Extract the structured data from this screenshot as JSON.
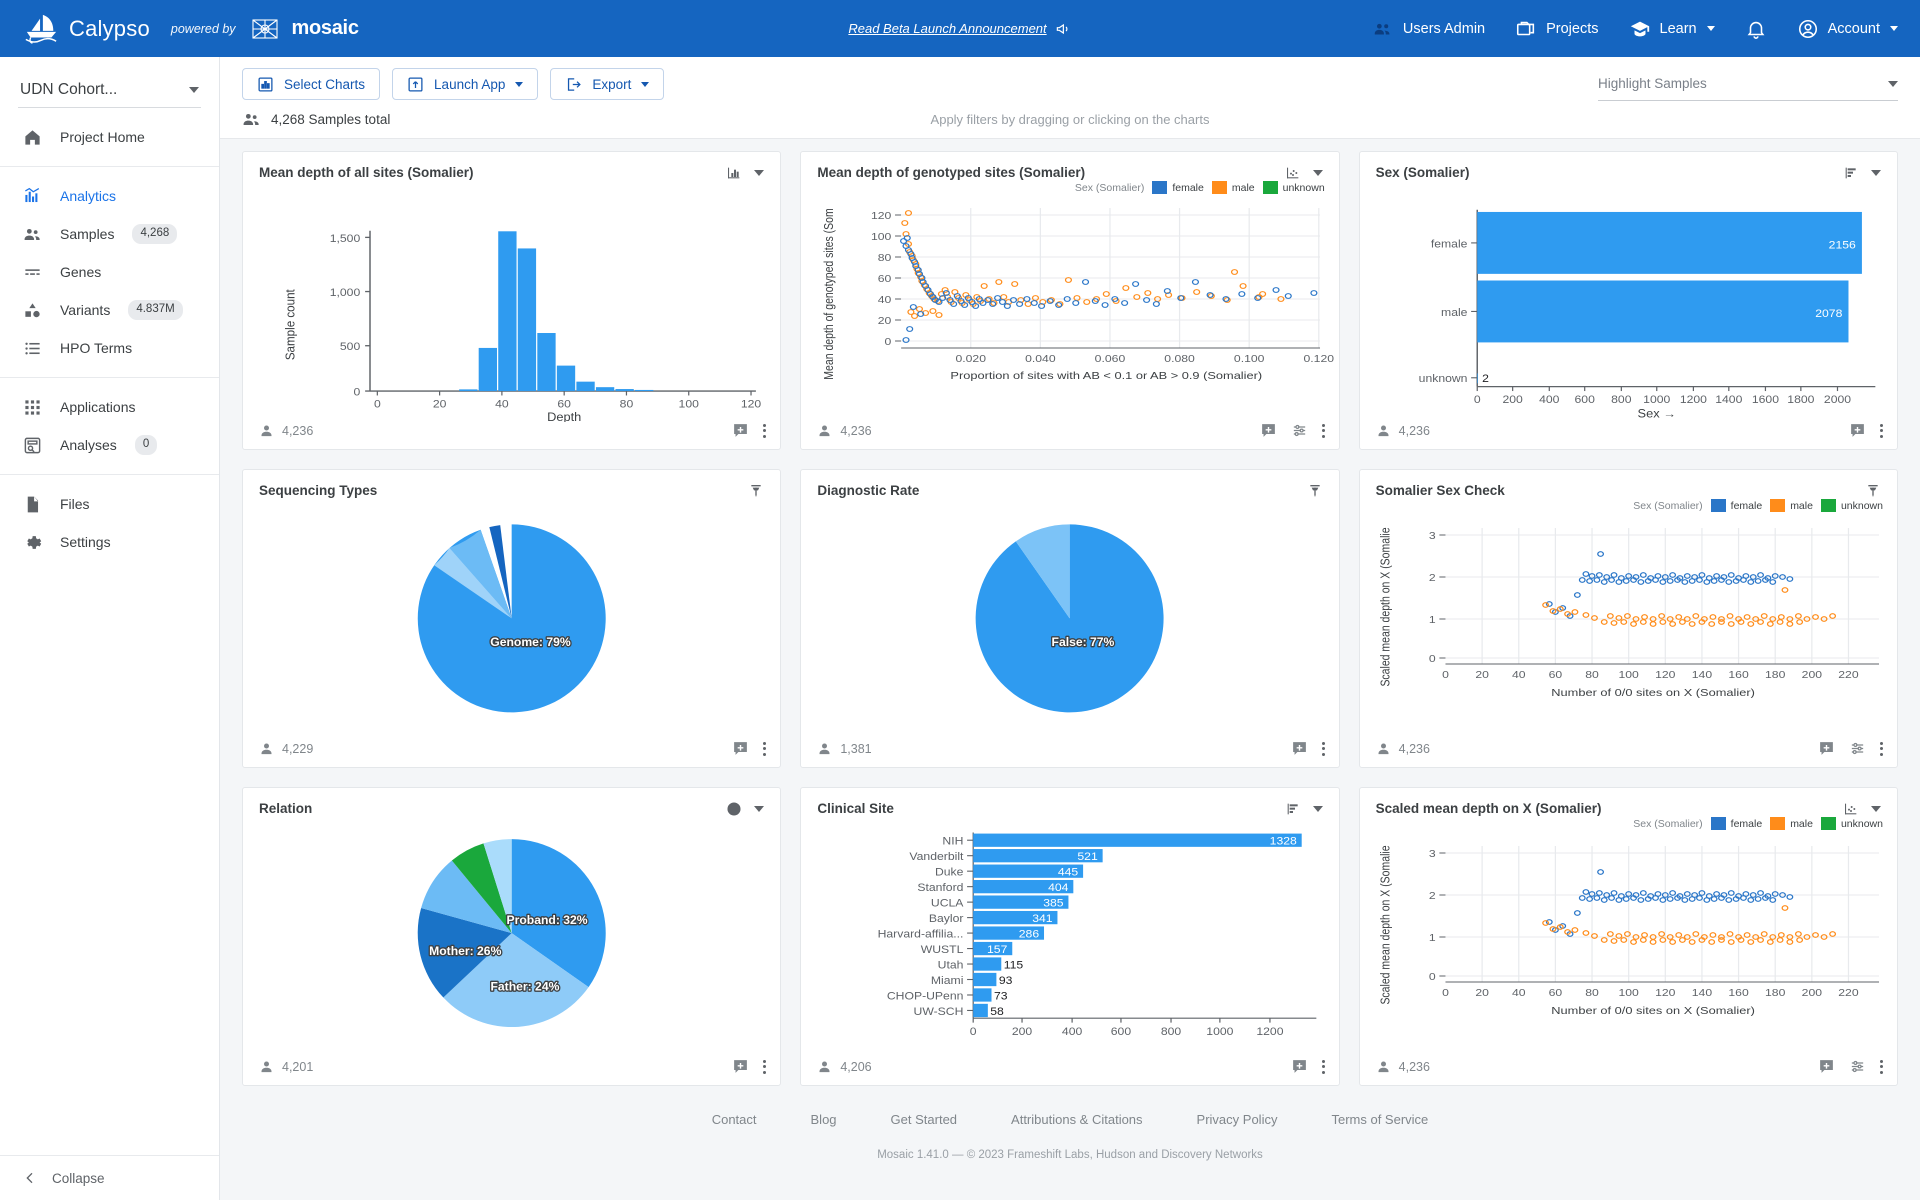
{
  "topbar": {
    "brand_name": "Calypso",
    "powered_by": "powered by",
    "mosaic": "mosaic",
    "announcement": "Read Beta Launch Announcement",
    "nav": [
      {
        "label": "Users Admin",
        "icon": "users-icon"
      },
      {
        "label": "Projects",
        "icon": "folder-icon"
      },
      {
        "label": "Learn",
        "icon": "school-icon",
        "caret": true
      },
      {
        "label": "",
        "icon": "bell-icon"
      },
      {
        "label": "Account",
        "icon": "account-icon",
        "caret": true
      }
    ],
    "accent": "#1565c0"
  },
  "sidebar": {
    "cohort": "UDN Cohort...",
    "groups": [
      {
        "items": [
          {
            "label": "Project Home",
            "icon": "home-icon",
            "badge": null,
            "active": false
          }
        ]
      },
      {
        "items": [
          {
            "label": "Analytics",
            "icon": "analytics-icon",
            "badge": null,
            "active": true
          },
          {
            "label": "Samples",
            "icon": "people-icon",
            "badge": "4,268",
            "active": false
          },
          {
            "label": "Genes",
            "icon": "genes-icon",
            "badge": null,
            "active": false
          },
          {
            "label": "Variants",
            "icon": "variants-icon",
            "badge": "4.837M",
            "active": false
          },
          {
            "label": "HPO Terms",
            "icon": "list-icon",
            "badge": null,
            "active": false
          }
        ]
      },
      {
        "items": [
          {
            "label": "Applications",
            "icon": "apps-icon",
            "badge": null,
            "active": false
          },
          {
            "label": "Analyses",
            "icon": "analyses-icon",
            "badge": "0",
            "active": false
          }
        ]
      },
      {
        "items": [
          {
            "label": "Files",
            "icon": "files-icon",
            "badge": null,
            "active": false
          },
          {
            "label": "Settings",
            "icon": "gear-icon",
            "badge": null,
            "active": false
          }
        ]
      }
    ],
    "collapse": "Collapse"
  },
  "toolbar": {
    "select_charts": "Select Charts",
    "launch_app": "Launch App",
    "export": "Export",
    "highlight_samples": "Highlight Samples",
    "samples_total": "4,268 Samples total",
    "filter_hint": "Apply filters by dragging or clicking on the charts"
  },
  "legend": {
    "title": "Sex (Somalier)",
    "entries": [
      {
        "label": "female",
        "color": "#2a76c8"
      },
      {
        "label": "male",
        "color": "#ff8c1a"
      },
      {
        "label": "unknown",
        "color": "#1aa83c"
      }
    ]
  },
  "cards": [
    {
      "title": "Mean depth of all sites (Somalier)",
      "count": "4,236",
      "tools": [
        "histogram-icon",
        "chevron-down-icon"
      ],
      "foot_tools": [
        "comment-add-icon",
        "more-icon"
      ]
    },
    {
      "title": "Mean depth of genotyped sites (Somalier)",
      "count": "4,236",
      "tools": [
        "scatter-icon",
        "chevron-down-icon"
      ],
      "foot_tools": [
        "comment-add-icon",
        "settings-sliders-icon",
        "more-icon"
      ]
    },
    {
      "title": "Sex (Somalier)",
      "count": "4,236",
      "tools": [
        "bar-icon",
        "chevron-down-icon"
      ],
      "foot_tools": [
        "comment-add-icon",
        "more-icon"
      ]
    },
    {
      "title": "Sequencing Types",
      "count": "4,229",
      "tools": [
        "pin-icon"
      ],
      "foot_tools": [
        "comment-add-icon",
        "more-icon"
      ]
    },
    {
      "title": "Diagnostic Rate",
      "count": "1,381",
      "tools": [
        "pin-icon"
      ],
      "foot_tools": [
        "comment-add-icon",
        "more-icon"
      ]
    },
    {
      "title": "Somalier Sex Check",
      "count": "4,236",
      "tools": [
        "pin-icon"
      ],
      "foot_tools": [
        "comment-add-icon",
        "settings-sliders-icon",
        "more-icon"
      ]
    },
    {
      "title": "Relation",
      "count": "4,201",
      "tools": [
        "pie-icon",
        "chevron-down-icon"
      ],
      "foot_tools": [
        "comment-add-icon",
        "more-icon"
      ]
    },
    {
      "title": "Clinical Site",
      "count": "4,206",
      "tools": [
        "bar-icon",
        "chevron-down-icon"
      ],
      "foot_tools": [
        "comment-add-icon",
        "more-icon"
      ]
    },
    {
      "title": "Scaled mean depth on X (Somalier)",
      "count": "4,236",
      "tools": [
        "scatter-icon",
        "chevron-down-icon"
      ],
      "foot_tools": [
        "comment-add-icon",
        "settings-sliders-icon",
        "more-icon"
      ]
    }
  ],
  "footer": {
    "links": [
      "Contact",
      "Blog",
      "Get Started",
      "Attributions & Citations",
      "Privacy Policy",
      "Terms of Service"
    ],
    "copyright": "Mosaic 1.41.0 — © 2023 Frameshift Labs, Hudson and Discovery Networks"
  },
  "chart_data": [
    {
      "id": "mean-depth-all-sites",
      "type": "bar",
      "title": "Mean depth of all sites (Somalier)",
      "xlabel": "Depth",
      "ylabel": "Sample count",
      "xlim": [
        0,
        128
      ],
      "ylim": [
        0,
        1600
      ],
      "xticks": [
        0,
        20,
        40,
        60,
        80,
        100,
        120
      ],
      "yticks": [
        0,
        500,
        1000,
        1500
      ],
      "bin_width": 5,
      "bins_x": [
        30,
        35,
        40,
        45,
        50,
        55,
        60,
        65,
        70,
        75
      ],
      "values": [
        18,
        400,
        1490,
        1325,
        540,
        235,
        85,
        30,
        14,
        8
      ],
      "color": "#2f9bf0",
      "grid": false
    },
    {
      "id": "mean-depth-genotyped",
      "type": "scatter",
      "title": "Mean depth of genotyped sites (Somalier)",
      "xlabel": "Proportion of sites with AB < 0.1 or AB > 0.9 (Somalier)",
      "ylabel": "Mean depth of genotyped sites (Som...",
      "xlim": [
        0,
        0.132
      ],
      "ylim": [
        0,
        128
      ],
      "xticks": [
        0.02,
        0.04,
        0.06,
        0.08,
        0.1,
        0.12
      ],
      "yticks": [
        0,
        20,
        40,
        60,
        80,
        100,
        120
      ],
      "legend_title": "Sex (Somalier)",
      "series": [
        {
          "name": "female",
          "color": "#2a76c8"
        },
        {
          "name": "male",
          "color": "#ff8c1a"
        },
        {
          "name": "unknown",
          "color": "#1aa83c"
        }
      ],
      "grid": true
    },
    {
      "id": "sex-somalier",
      "type": "bar",
      "orientation": "horizontal",
      "title": "Sex (Somalier)",
      "xlabel": "Sex →",
      "categories": [
        "female",
        "male",
        "unknown"
      ],
      "values": [
        2156,
        2078,
        2
      ],
      "xlim": [
        0,
        2200
      ],
      "xticks": [
        0,
        200,
        400,
        600,
        800,
        1000,
        1200,
        1400,
        1600,
        1800,
        2000
      ],
      "color": "#2f9bf0"
    },
    {
      "id": "sequencing-types",
      "type": "pie",
      "title": "Sequencing Types",
      "labels": [
        "Genome: 79%",
        "",
        "",
        ""
      ],
      "values": [
        79,
        11,
        6,
        4
      ],
      "colors": [
        "#2f9bf0",
        "#6cbbf5",
        "#9fd3f9",
        "#1565c0"
      ],
      "main_label": "Genome: 79%"
    },
    {
      "id": "diagnostic-rate",
      "type": "pie",
      "title": "Diagnostic Rate",
      "labels": [
        "False: 77%",
        ""
      ],
      "values": [
        77,
        23
      ],
      "colors": [
        "#2f9bf0",
        "#7cc3f7"
      ],
      "main_label": "False: 77%"
    },
    {
      "id": "somalier-sex-check",
      "type": "scatter",
      "title": "Somalier Sex Check",
      "xlabel": "Number of 0/0 sites on X (Somalier)",
      "ylabel": "Scaled mean depth on X (Somalie...",
      "xlim": [
        0,
        228
      ],
      "ylim": [
        0,
        3.3
      ],
      "xticks": [
        0,
        20,
        40,
        60,
        80,
        100,
        120,
        140,
        160,
        180,
        200,
        220
      ],
      "yticks": [
        0,
        1,
        2,
        3
      ],
      "legend_title": "Sex (Somalier)",
      "series": [
        {
          "name": "female",
          "color": "#2a76c8"
        },
        {
          "name": "male",
          "color": "#ff8c1a"
        },
        {
          "name": "unknown",
          "color": "#1aa83c"
        }
      ],
      "grid": true
    },
    {
      "id": "relation",
      "type": "pie",
      "title": "Relation",
      "labels": [
        "Proband: 32%",
        "Mother: 26%",
        "Father: 24%",
        "",
        "",
        ""
      ],
      "values": [
        32,
        26,
        24,
        9,
        5,
        4
      ],
      "colors": [
        "#2f9bf0",
        "#1a73c7",
        "#8ecbf8",
        "#6cbbf5",
        "#1aa83c",
        "#aadcfb"
      ],
      "main_labels": [
        "Proband: 32%",
        "Mother: 26%",
        "Father: 24%"
      ]
    },
    {
      "id": "clinical-site",
      "type": "bar",
      "orientation": "horizontal",
      "title": "Clinical Site",
      "categories": [
        "NIH",
        "Vanderbilt",
        "Duke",
        "Stanford",
        "UCLA",
        "Baylor",
        "Harvard-affilia...",
        "WUSTL",
        "Utah",
        "Miami",
        "CHOP-UPenn",
        "UW-SCH"
      ],
      "values": [
        1328,
        521,
        445,
        404,
        385,
        341,
        286,
        157,
        115,
        93,
        73,
        58
      ],
      "xlim": [
        0,
        1400
      ],
      "xticks": [
        0,
        200,
        400,
        600,
        800,
        1000,
        1200
      ],
      "color": "#2f9bf0"
    },
    {
      "id": "scaled-mean-depth-x",
      "type": "scatter",
      "title": "Scaled mean depth on X (Somalier)",
      "xlabel": "Number of 0/0 sites on X (Somalier)",
      "ylabel": "Scaled mean depth on X (Somalie...",
      "xlim": [
        0,
        228
      ],
      "ylim": [
        0,
        3.3
      ],
      "xticks": [
        0,
        20,
        40,
        60,
        80,
        100,
        120,
        140,
        160,
        180,
        200,
        220
      ],
      "yticks": [
        0,
        1,
        2,
        3
      ],
      "legend_title": "Sex (Somalier)",
      "series": [
        {
          "name": "female",
          "color": "#2a76c8"
        },
        {
          "name": "male",
          "color": "#ff8c1a"
        },
        {
          "name": "unknown",
          "color": "#1aa83c"
        }
      ],
      "grid": true
    }
  ]
}
